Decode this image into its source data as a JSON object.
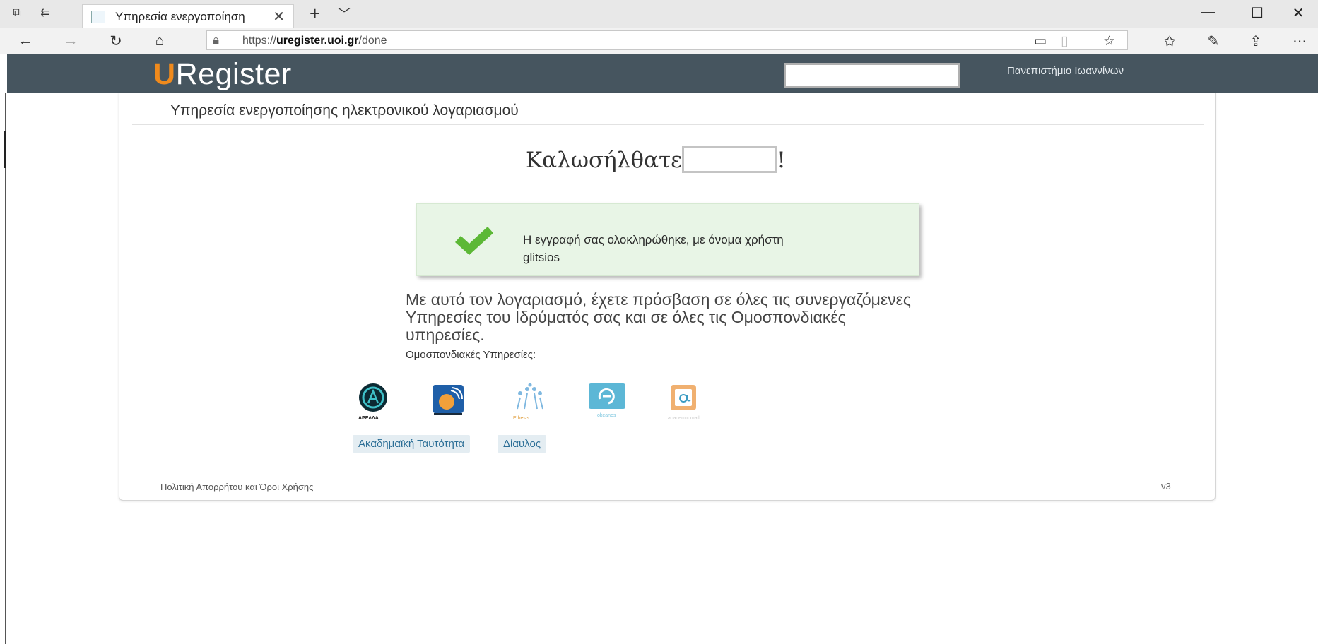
{
  "browser": {
    "tab_title": "Υπηρεσία ενεργοποίηση",
    "url_prefix": "https://",
    "url_domain": "uregister.uoi.gr",
    "url_path": "/done"
  },
  "header": {
    "logo_first": "U",
    "logo_rest": "Register",
    "institution": "Πανεπιστήμιο Ιωαννίνων"
  },
  "page": {
    "title": "Υπηρεσία ενεργοποίησης ηλεκτρονικού λογαριασμού",
    "welcome_prefix": "Καλωσήλθατε",
    "welcome_suffix": "!",
    "alert_line1": "Η εγγραφή σας ολοκληρώθηκε, με όνομα χρήστη",
    "alert_username": "glitsios",
    "info": "Με αυτό τον λογαριασμό, έχετε πρόσβαση σε όλες τις συνεργαζόμενες Υπηρεσίες του Ιδρύματός σας και σε όλες τις Ομοσπονδιακές υπηρεσίες.",
    "federated_label": "Ομοσπονδιακές Υπηρεσίες:",
    "logos": {
      "apella": "ΑΡΕΛΛΑ",
      "ethesis": "Ethesis",
      "okeanos": "okeanos",
      "academic_mail": "academic.mail"
    },
    "tags": [
      "Ακαδημαϊκή Ταυτότητα",
      "Δίαυλος"
    ]
  },
  "footer": {
    "privacy_link": "Πολιτική Απορρήτου και Όροι Χρήσης",
    "version": "v3"
  },
  "colors": {
    "header_bg": "#46555f",
    "logo_accent": "#f08a1c",
    "success_bg": "#e8f5e6",
    "check_green": "#5cb836",
    "tag_text": "#2b6e96"
  }
}
